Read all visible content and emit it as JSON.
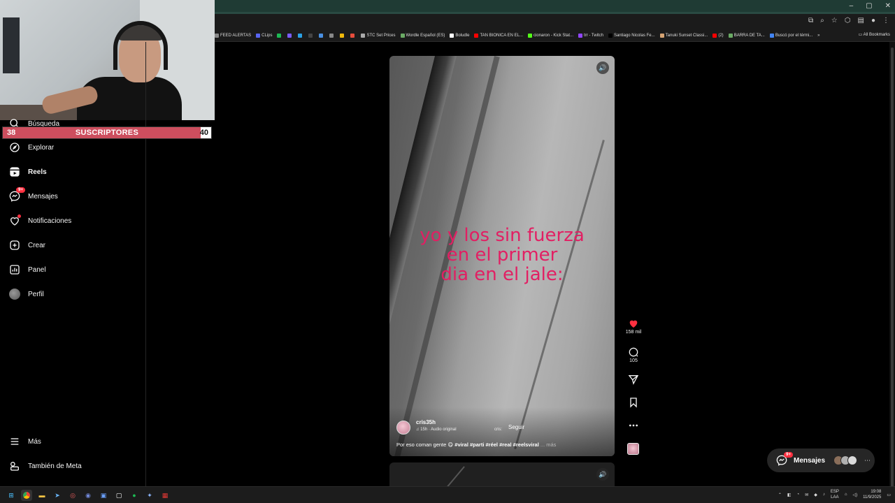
{
  "window": {
    "controls": [
      "–",
      "▢",
      "✕"
    ]
  },
  "bookmarks": {
    "items": [
      {
        "label": "FEED ALERTAS",
        "color": "#888888"
      },
      {
        "label": "CLips",
        "color": "#5865f2"
      },
      {
        "label": "",
        "color": "#1db954"
      },
      {
        "label": "",
        "color": "#7a5cff"
      },
      {
        "label": "",
        "color": "#2aa1e5"
      },
      {
        "label": "",
        "color": "#444444"
      },
      {
        "label": "",
        "color": "#4a90e2"
      },
      {
        "label": "",
        "color": "#888888"
      },
      {
        "label": "",
        "color": "#f0b90b"
      },
      {
        "label": "",
        "color": "#e74c3c"
      },
      {
        "label": "STC Set Prices",
        "color": "#aaaaaa"
      },
      {
        "label": "Wordle Español (ES)",
        "color": "#6aaa64"
      },
      {
        "label": "Boludle",
        "color": "#ffffff"
      },
      {
        "label": "TAN BIONICA EN EL...",
        "color": "#ff0000"
      },
      {
        "label": "cionaron - Kick Stat...",
        "color": "#53fc18"
      },
      {
        "label": "trr - Twitch",
        "color": "#9146ff"
      },
      {
        "label": "Santiago Nicolas Fe...",
        "color": "#000000"
      },
      {
        "label": "Tanuki Sunset Classi...",
        "color": "#d4a373"
      },
      {
        "label": "(2)",
        "color": "#ff0000"
      },
      {
        "label": "BARRA DE TA...",
        "color": "#6aaa64"
      },
      {
        "label": "Buscó por el térmi...",
        "color": "#4285f4"
      }
    ],
    "all_bookmarks": "All Bookmarks"
  },
  "overlay": {
    "sub_current": "38",
    "sub_label": "SUSCRIPTORES",
    "sub_goal": "40",
    "sub_progress": 0.95
  },
  "sidebar": {
    "items": [
      {
        "label": "Búsqueda",
        "icon": "search-icon"
      },
      {
        "label": "Explorar",
        "icon": "compass-icon"
      },
      {
        "label": "Reels",
        "icon": "reels-icon"
      },
      {
        "label": "Mensajes",
        "icon": "messenger-icon",
        "badge": "9+"
      },
      {
        "label": "Notificaciones",
        "icon": "heart-icon"
      },
      {
        "label": "Crear",
        "icon": "plus-square-icon"
      },
      {
        "label": "Panel",
        "icon": "dashboard-icon"
      },
      {
        "label": "Perfil",
        "icon": "avatar"
      }
    ],
    "more": "Más",
    "meta": "También de Meta"
  },
  "reel": {
    "caption_lines": [
      "yo y los sin fuerza",
      "en el primer",
      "dia en el jale:"
    ],
    "author": "cris35h",
    "audio": "15h · Audio original",
    "audio_owner": "cris:",
    "follow": "Seguir",
    "description": "Por eso coman gente 😋",
    "hashtags": "#viral #parti #réel #real #reelsviral",
    "more": "... más"
  },
  "actions": {
    "likes": "158 mil",
    "comments": "105"
  },
  "messages_pill": {
    "label": "Mensajes",
    "badge": "9+"
  },
  "taskbar": {
    "lang_top": "ESP",
    "lang_bottom": "LAA",
    "time": "19:08",
    "date": "11/9/2025"
  },
  "colors": {
    "caption": "#e21f63",
    "badge": "#ff3040",
    "sub_fill": "#cd4e5e"
  }
}
